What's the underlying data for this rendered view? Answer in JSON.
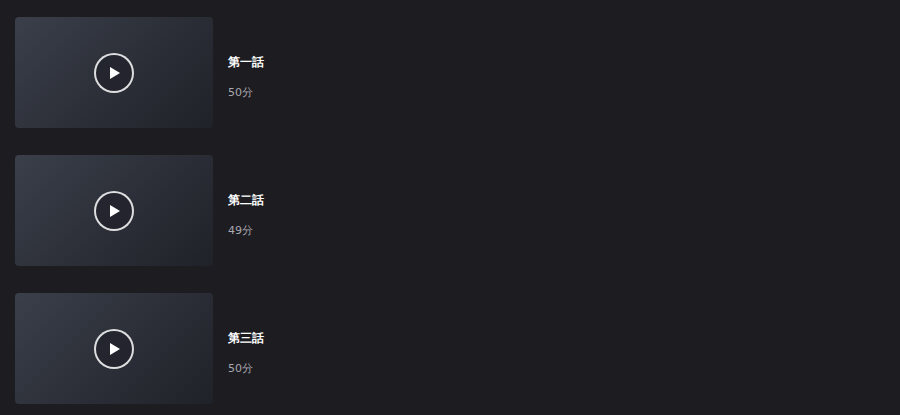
{
  "episodes": [
    {
      "title": "第一話",
      "duration": "50分"
    },
    {
      "title": "第二話",
      "duration": "49分"
    },
    {
      "title": "第三話",
      "duration": "50分"
    }
  ]
}
